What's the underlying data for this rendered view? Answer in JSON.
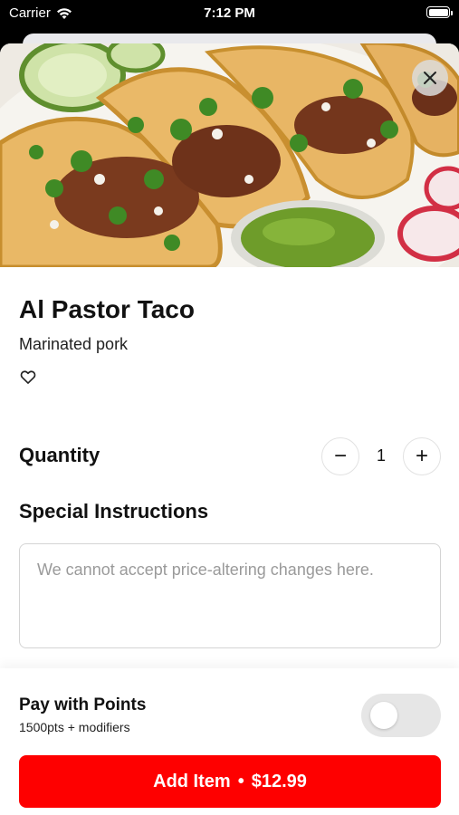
{
  "status_bar": {
    "carrier": "Carrier",
    "time": "7:12 PM",
    "icons": [
      "wifi-icon",
      "battery-icon"
    ]
  },
  "hero": {
    "image": "tacos-photo",
    "close_icon": "close-icon"
  },
  "item": {
    "title": "Al Pastor Taco",
    "description": "Marinated pork",
    "favorite_icon": "heart-outline-icon"
  },
  "quantity": {
    "label": "Quantity",
    "value": "1",
    "minus_label": "−",
    "plus_label": "+"
  },
  "instructions": {
    "label": "Special Instructions",
    "placeholder": "We cannot accept price-altering changes here."
  },
  "points": {
    "label": "Pay with Points",
    "sublabel": "1500pts + modifiers",
    "toggle_on": false
  },
  "add_button": {
    "label": "Add Item",
    "separator": "•",
    "price": "$12.99"
  },
  "colors": {
    "accent": "#fe0000",
    "toggle_off": "#e6e6e6",
    "text": "#111111",
    "placeholder": "#9a9a9a"
  }
}
